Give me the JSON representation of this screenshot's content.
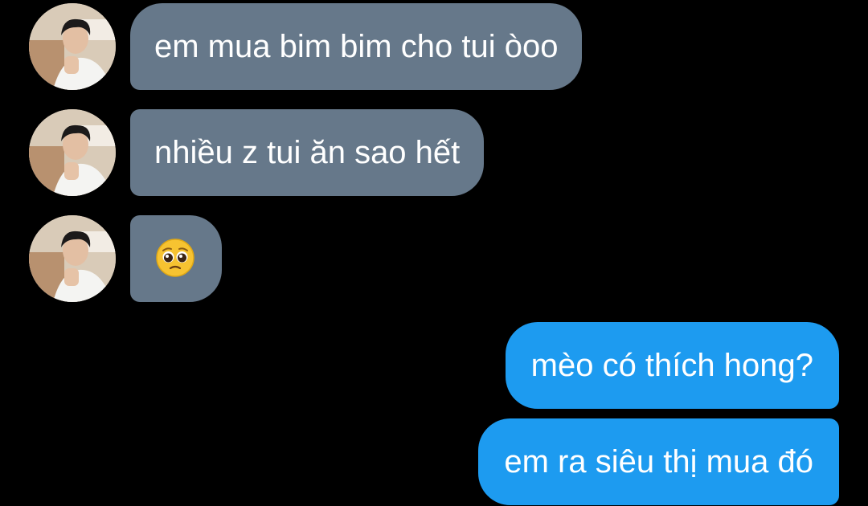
{
  "conversation": {
    "received": [
      {
        "text": "em mua bim bim cho tui òoo",
        "avatar_icon": "user-avatar-photo"
      },
      {
        "text": "nhiều z tui ăn sao hết",
        "avatar_icon": "user-avatar-photo"
      },
      {
        "emoji": "pleading-face-emoji",
        "avatar_icon": "user-avatar-photo"
      }
    ],
    "sent": [
      {
        "text": "mèo có thích hong?"
      },
      {
        "text": "em ra siêu thị mua đó"
      }
    ]
  },
  "colors": {
    "background": "#000000",
    "received_bubble": "#66788a",
    "sent_bubble": "#1d9bf0",
    "text": "#ffffff"
  }
}
